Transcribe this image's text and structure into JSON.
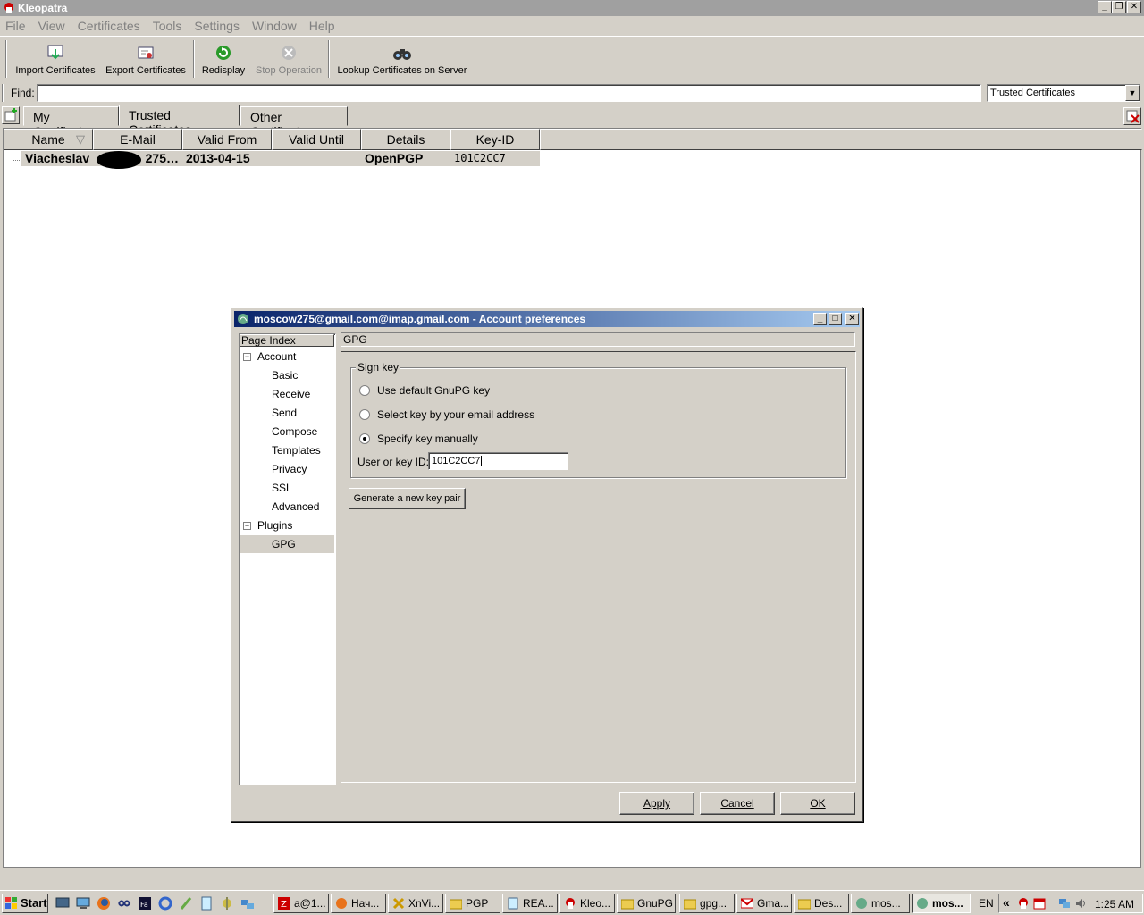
{
  "window": {
    "title": "Kleopatra"
  },
  "menu": [
    "File",
    "View",
    "Certificates",
    "Tools",
    "Settings",
    "Window",
    "Help"
  ],
  "toolbar": {
    "import": "Import Certificates",
    "export": "Export Certificates",
    "redisplay": "Redisplay",
    "stop": "Stop Operation",
    "lookup": "Lookup Certificates on Server"
  },
  "find": {
    "label": "Find:",
    "value": "",
    "filter": "Trusted Certificates"
  },
  "tabs": [
    "My Certificates",
    "Trusted Certificates",
    "Other Certificates"
  ],
  "columns": [
    "Name",
    "E-Mail",
    "Valid From",
    "Valid Until",
    "Details",
    "Key-ID"
  ],
  "rows": [
    {
      "name": "Viacheslav",
      "email": "275…",
      "valid_from": "2013-04-15",
      "valid_until": "",
      "details": "OpenPGP",
      "key_id": "101C2CC7"
    }
  ],
  "dialog": {
    "title": "moscow275@gmail.com@imap.gmail.com - Account preferences",
    "page_index": "Page Index",
    "tree": {
      "account": "Account",
      "account_children": [
        "Basic",
        "Receive",
        "Send",
        "Compose",
        "Templates",
        "Privacy",
        "SSL",
        "Advanced"
      ],
      "plugins": "Plugins",
      "plugins_children": [
        "GPG"
      ]
    },
    "page_title": "GPG",
    "group": "Sign key",
    "options": [
      "Use default GnuPG key",
      "Select key by your email address",
      "Specify key manually"
    ],
    "selected_option": 2,
    "key_label": "User or key ID:",
    "key_value": "101C2CC7",
    "generate": "Generate a new key pair",
    "apply": "Apply",
    "cancel": "Cancel",
    "ok": "OK"
  },
  "taskbar": {
    "start": "Start",
    "tasks": [
      "a@1...",
      "Нач...",
      "XnVi...",
      "PGP",
      "REA...",
      "Kleo...",
      "GnuPG",
      "gpg...",
      "Gma...",
      "Des...",
      "mos...",
      "mos..."
    ],
    "lang": "EN",
    "clock": "1:25 AM",
    "chevron": "«"
  },
  "colors": {
    "title_active": "#0a246a",
    "title_inactive": "#a0a0a0",
    "face": "#d4d0c8"
  }
}
